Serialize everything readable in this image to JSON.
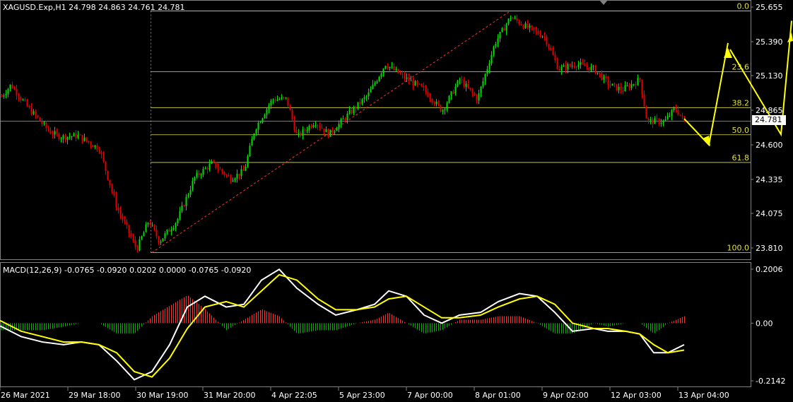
{
  "header": {
    "symbol": "XAGUSD.Exp,H1",
    "ohlc": "24.798 24.863 24.761 24.781"
  },
  "macd": {
    "label": "MACD(12,26,9) -0.0765 -0.0920 0.0202 0.0000 -0.0765 -0.0920",
    "axis_ticks": [
      "0.2006",
      "0.00",
      "-0.2142"
    ],
    "axis_values": [
      0.2006,
      0.0,
      -0.2142
    ]
  },
  "price_axis": {
    "ticks": [
      "25.655",
      "25.390",
      "25.130",
      "24.865",
      "24.600",
      "24.335",
      "24.075",
      "23.810"
    ],
    "values": [
      25.655,
      25.39,
      25.13,
      24.865,
      24.6,
      24.335,
      24.075,
      23.81
    ],
    "current_price": "24.781",
    "current_value": 24.781
  },
  "fibonacci": {
    "levels": [
      {
        "label": "0.0",
        "price": 25.625
      },
      {
        "label": "23.6",
        "price": 25.16
      },
      {
        "label": "38.2",
        "price": 24.885
      },
      {
        "label": "50.0",
        "price": 24.677
      },
      {
        "label": "61.8",
        "price": 24.465
      },
      {
        "label": "100.0",
        "price": 23.775
      }
    ]
  },
  "time_axis": {
    "labels": [
      "26 Mar 2021",
      "29 Mar 18:00",
      "30 Mar 19:00",
      "31 Mar 20:00",
      "4 Apr 22:05",
      "5 Apr 23:00",
      "7 Apr 00:00",
      "8 Apr 01:00",
      "9 Apr 02:00",
      "12 Apr 03:00",
      "13 Apr 04:00"
    ]
  },
  "colors": {
    "background": "#000000",
    "bull": "#00e000",
    "bear": "#e00000",
    "fib": "#e0e040",
    "macd_main": "#ffffff",
    "macd_signal": "#ffff00",
    "hist_pos": "#ff3030",
    "hist_neg": "#00b000",
    "forecast": "#ffff00",
    "trend": "#ff3030",
    "grid": "#c0c0c0",
    "border": "#808080"
  }
}
